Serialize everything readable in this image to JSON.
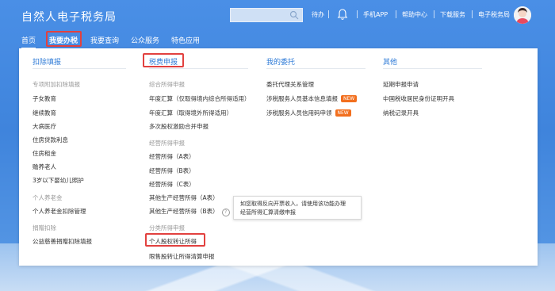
{
  "header": {
    "logo": "自然人电子税务局",
    "search_placeholder": "",
    "links": {
      "todo": "待办",
      "mobile_app": "手机APP",
      "help": "帮助中心",
      "download": "下载服务",
      "etax": "电子税务局"
    }
  },
  "nav": {
    "items": [
      "首页",
      "我要办税",
      "我要查询",
      "公众服务",
      "特色应用"
    ]
  },
  "menu": {
    "col1": {
      "title": "扣除填报",
      "cat1": "专项附加扣除填报",
      "items1": [
        "子女教育",
        "继续教育",
        "大病医疗",
        "住房贷款利息",
        "住房租金",
        "赡养老人",
        "3岁以下婴幼儿照护"
      ],
      "cat2": "个人养老金",
      "items2": [
        "个人养老金扣除管理"
      ],
      "cat3": "捐赠扣除",
      "items3": [
        "公益慈善捐赠扣除填报"
      ]
    },
    "col2": {
      "title": "税费申报",
      "cat1": "综合所得申报",
      "items1": [
        "年度汇算（仅取得境内综合所得适用）",
        "年度汇算（取得境外所得适用）",
        "多次股权激励合并申报"
      ],
      "cat2": "经营所得申报",
      "items2": [
        "经营所得（A表）",
        "经营所得（B表）",
        "经营所得（C表）",
        "其他生产经营所得（A表）",
        "其他生产经营所得（B表）"
      ],
      "cat3": "分类所得申报",
      "items3": [
        "个人股权转让所得",
        "限售股转让所得清算申报"
      ]
    },
    "col3": {
      "title": "我的委托",
      "items": [
        "委托代理关系管理",
        "涉税服务人员基本信息填报",
        "涉税服务人员信用码申领"
      ],
      "badge": "NEW"
    },
    "col4": {
      "title": "其他",
      "items": [
        "延期申报申请",
        "中国税收居民身份证明开具",
        "纳税记录开具"
      ]
    }
  },
  "tooltip": {
    "line1": "如您取得反向开票收入，请使用该功能办理",
    "line2": "经营所得汇算清缴申报"
  },
  "colors": {
    "accent": "#2f7bd7",
    "highlight": "#e2413f",
    "badge": "#f26f1e"
  }
}
